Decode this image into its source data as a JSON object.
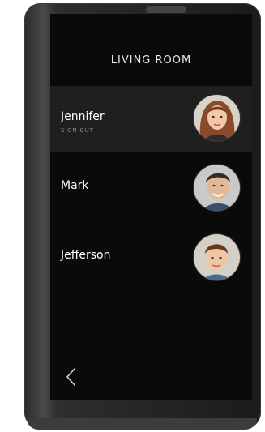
{
  "room": {
    "title": "LIVING ROOM"
  },
  "users": [
    {
      "name": "Jennifer",
      "action": "SIGN OUT",
      "avatar_icon": "jennifer-avatar",
      "active": true
    },
    {
      "name": "Mark",
      "action": "",
      "avatar_icon": "mark-avatar",
      "active": false
    },
    {
      "name": "Jefferson",
      "action": "",
      "avatar_icon": "jefferson-avatar",
      "active": false
    }
  ],
  "navigation": {
    "back_icon": "chevron-left-icon"
  },
  "colors": {
    "screen_bg": "#0a0a0a",
    "active_row_bg": "#1f1f1f",
    "text_primary": "#ffffff",
    "text_secondary": "#8a8a8a"
  }
}
